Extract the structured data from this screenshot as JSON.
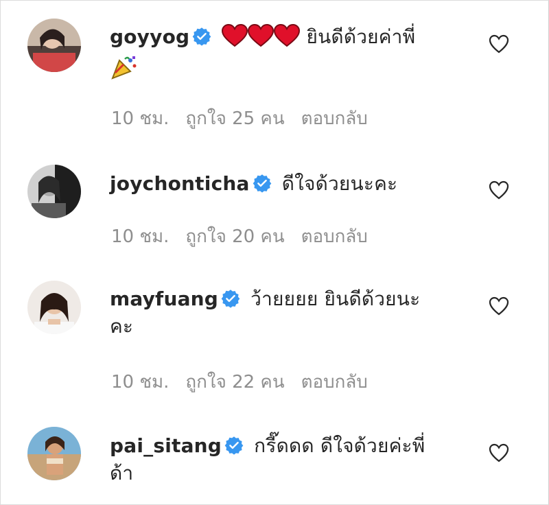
{
  "comments": [
    {
      "username": "goyyog",
      "text": "ยินดีด้วยค่าพี่",
      "time": "10 ชม.",
      "likes": "ถูกใจ 25 คน",
      "reply": "ตอบกลับ"
    },
    {
      "username": "joychonticha",
      "text": "ดีใจด้วยนะคะ",
      "time": "10 ชม.",
      "likes": "ถูกใจ 20 คน",
      "reply": "ตอบกลับ"
    },
    {
      "username": "mayfuang",
      "text": "ว้ายยยย ยินดีด้วยนะ",
      "text_line2": "คะ",
      "time": "10 ชม.",
      "likes": "ถูกใจ 22 คน",
      "reply": "ตอบกลับ"
    },
    {
      "username": "pai_sitang",
      "text": "กรี๊ดดด ดีใจด้วยค่ะพี่",
      "text_line2": "ด้า"
    }
  ],
  "icons": {
    "verified": "verified-badge-icon",
    "heart_emoji": "red-heart-emoji",
    "party_emoji": "party-popper-emoji",
    "like": "heart-outline-icon"
  },
  "colors": {
    "verified": "#3897f0",
    "meta_text": "#8e8e8e",
    "heart_emoji": "#e0102a"
  }
}
